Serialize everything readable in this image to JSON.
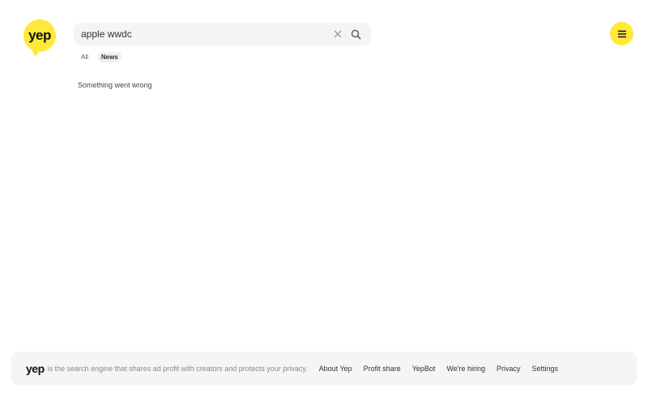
{
  "logo": "yep",
  "search": {
    "value": "apple wwdc",
    "clear_icon": "close-icon",
    "search_icon": "search-icon"
  },
  "tabs": [
    {
      "label": "All",
      "active": false
    },
    {
      "label": "News",
      "active": true
    }
  ],
  "message": "Something went wrong",
  "menu_icon": "hamburger-icon",
  "footer": {
    "logo": "yep",
    "tagline": "is the search engine that shares ad profit with creators and protects your privacy.",
    "links": [
      "About Yep",
      "Profit share",
      "YepBot",
      "We're hiring",
      "Privacy",
      "Settings"
    ]
  },
  "colors": {
    "brand": "#ffe83a"
  }
}
